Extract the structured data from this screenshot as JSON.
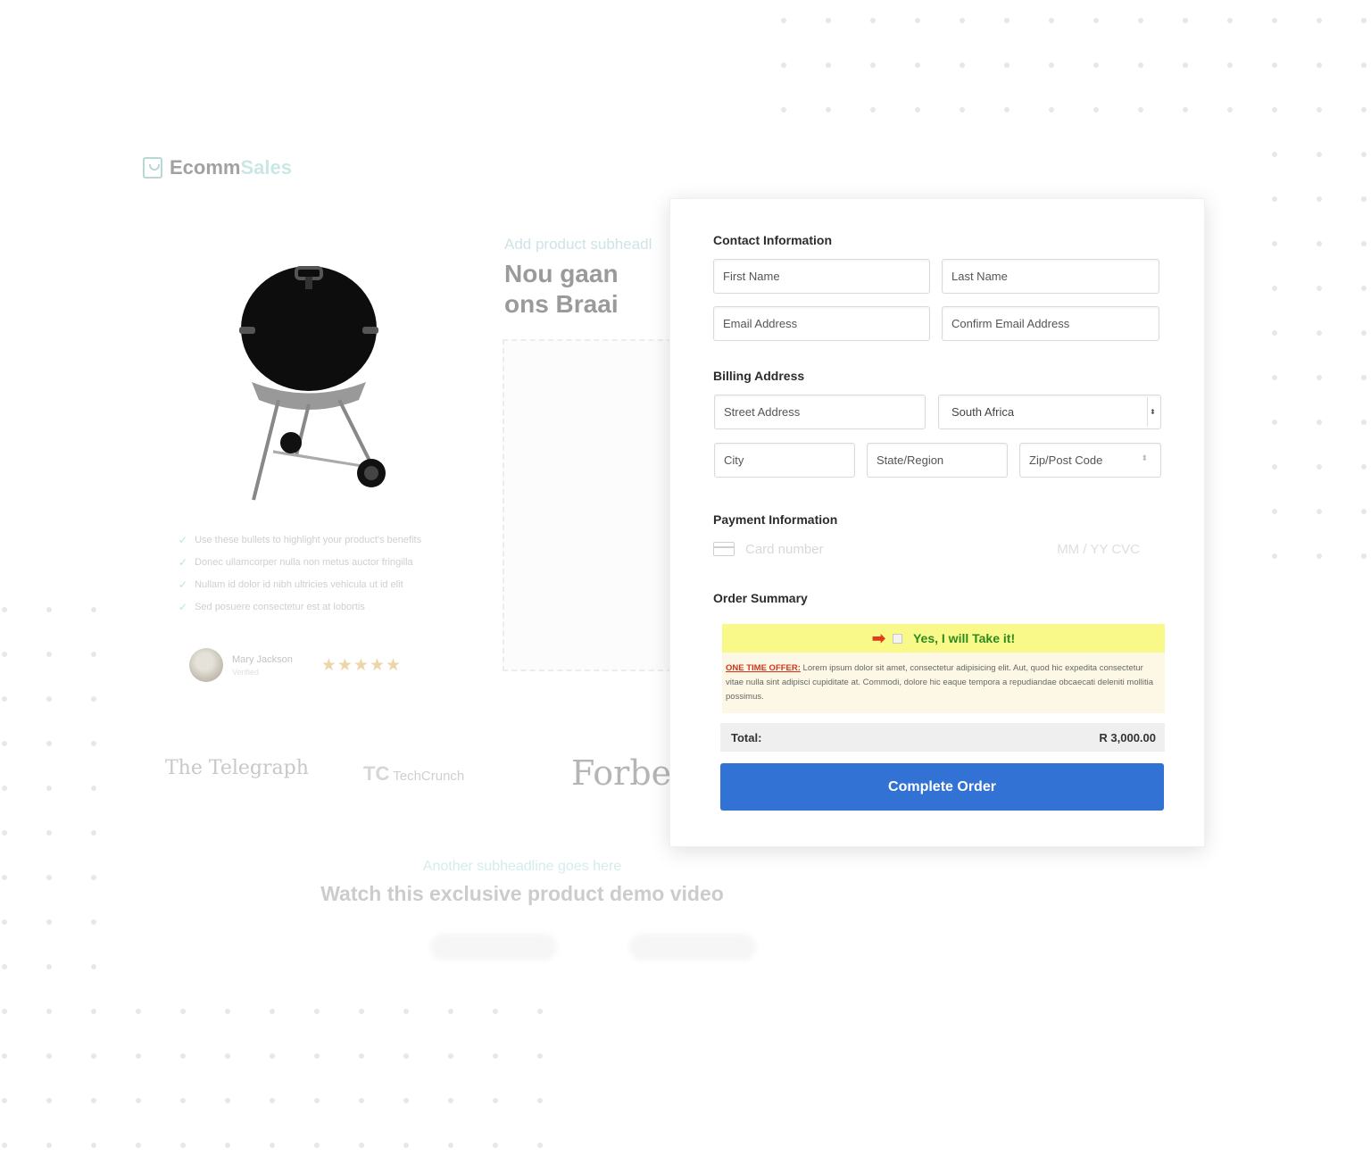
{
  "brand": {
    "name_part1": "Ecomm",
    "name_part2": "Sales"
  },
  "product": {
    "image_alt": "kettle-grill",
    "subheadline": "Add product subheadl",
    "headline": "Nou gaan ons Braai",
    "bullets": [
      "Use these bullets to highlight your product's benefits",
      "Donec ullamcorper nulla non metus auctor fringilla",
      "Nullam id dolor id nibh ultricies vehicula ut id elit",
      "Sed posuere consectetur est at lobortis"
    ],
    "review": {
      "name": "Mary Jackson",
      "subtitle": "Verified",
      "stars": "★★★★★"
    }
  },
  "press": {
    "telegraph": "The Telegraph",
    "techcrunch_mark": "TC",
    "techcrunch": "TechCrunch",
    "forbes": "Forbes"
  },
  "demo": {
    "subheadline": "Another subheadline goes here",
    "headline": "Watch this exclusive product demo video"
  },
  "form": {
    "contact_title": "Contact Information",
    "first_name_placeholder": "First Name",
    "last_name_placeholder": "Last Name",
    "email_placeholder": "Email Address",
    "confirm_email_placeholder": "Confirm Email Address",
    "billing_title": "Billing Address",
    "street_placeholder": "Street Address",
    "country_value": "South Africa",
    "city_placeholder": "City",
    "state_placeholder": "State/Region",
    "zip_placeholder": "Zip/Post Code",
    "payment_title": "Payment Information",
    "card_number_placeholder": "Card number",
    "card_exp_placeholder": "MM / YY  CVC",
    "summary_title": "Order Summary",
    "upsell_checkbox_label": "Yes, I will Take it!",
    "upsell_arrow": "➡",
    "offer_label": "ONE TIME OFFER:",
    "offer_text": " Lorem ipsum dolor sit amet, consectetur adipisicing elit. Aut, quod hic expedita consectetur vitae nulla sint adipisci cupiditate at. Commodi, dolore hic eaque tempora a repudiandae obcaecati deleniti mollitia possimus.",
    "total_label": "Total:",
    "total_value": "R 3,000.00",
    "submit_label": "Complete Order"
  },
  "colors": {
    "accent": "#3172d4",
    "upsell_bar": "#f9f98a",
    "offer_bg": "#fdf8e6",
    "offer_red": "#d4331b",
    "yes_green": "#2d8a1e"
  }
}
